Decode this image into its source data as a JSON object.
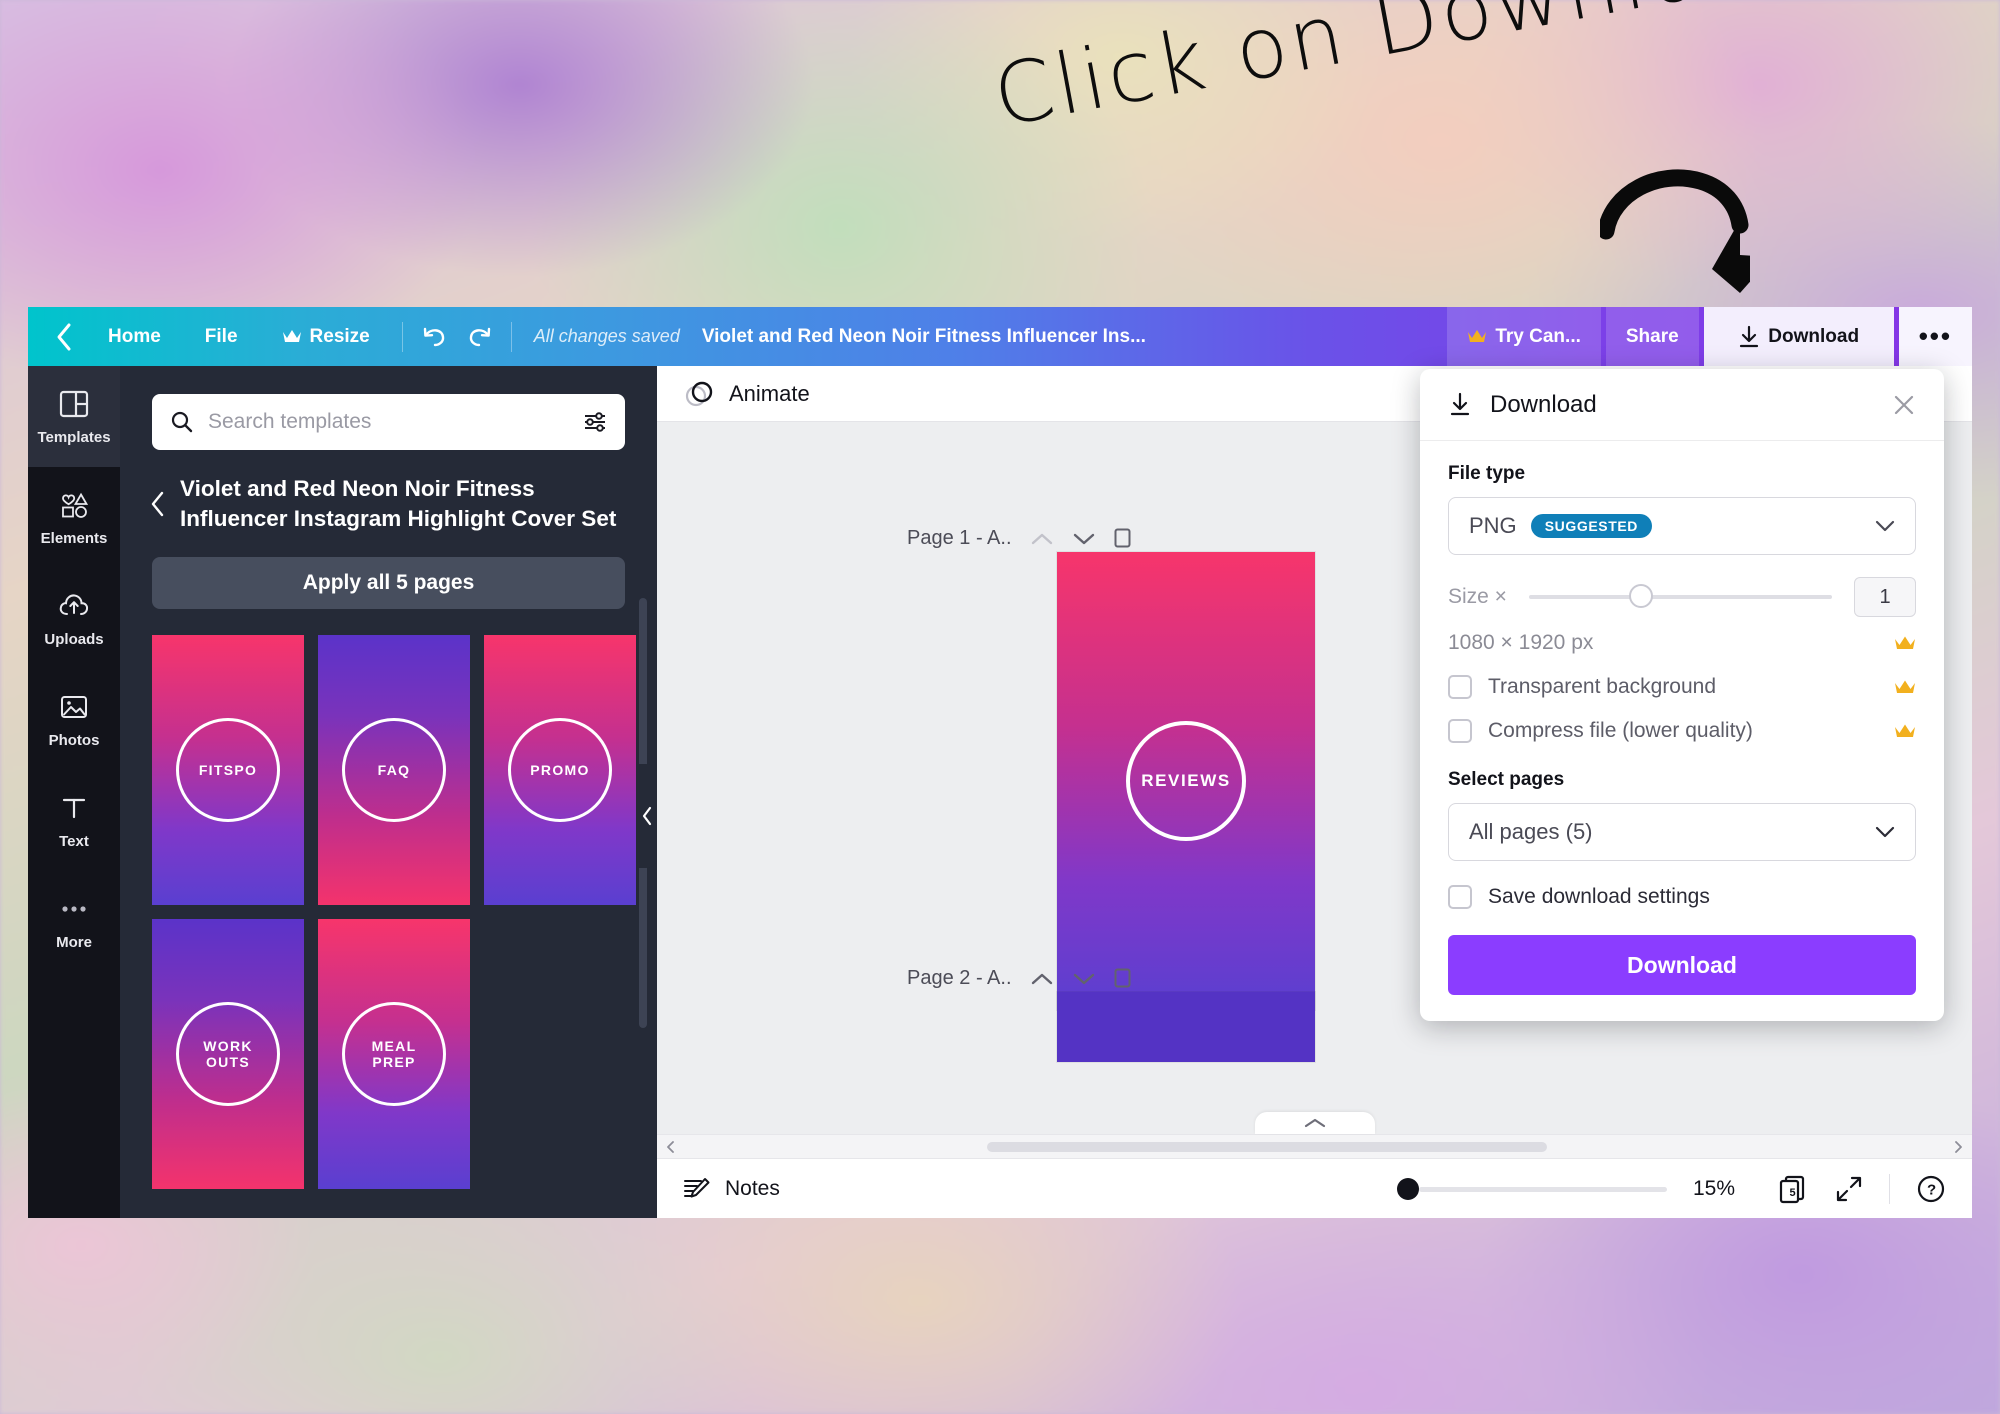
{
  "annotation": {
    "text": "Click on Download",
    "arrow_icon": "curved-arrow-icon"
  },
  "topbar": {
    "back_icon": "chevron-left-icon",
    "home_label": "Home",
    "file_label": "File",
    "resize_label": "Resize",
    "resize_icon": "crown-icon",
    "undo_icon": "undo-icon",
    "redo_icon": "redo-icon",
    "save_status": "All changes saved",
    "doc_title": "Violet and Red Neon Noir Fitness Influencer Ins...",
    "try_canva_label": "Try Can...",
    "try_canva_icon": "crown-icon",
    "share_label": "Share",
    "download_label": "Download",
    "download_icon": "download-icon",
    "more_label": "•••"
  },
  "rail": {
    "items": [
      {
        "label": "Templates",
        "icon": "templates-icon",
        "active": true
      },
      {
        "label": "Elements",
        "icon": "elements-icon",
        "active": false
      },
      {
        "label": "Uploads",
        "icon": "uploads-icon",
        "active": false
      },
      {
        "label": "Photos",
        "icon": "photos-icon",
        "active": false
      },
      {
        "label": "Text",
        "icon": "text-icon",
        "active": false
      },
      {
        "label": "More",
        "icon": "more-dots-icon",
        "active": false
      }
    ]
  },
  "panel": {
    "search_placeholder": "Search templates",
    "search_value": "",
    "search_icon": "search-icon",
    "filter_icon": "sliders-icon",
    "back_icon": "chevron-left-icon",
    "title": "Violet and Red Neon Noir Fitness Influencer Instagram Highlight Cover Set",
    "apply_label": "Apply all 5 pages",
    "collapse_icon": "chevron-left-icon",
    "thumbnails": [
      {
        "label": "FITSPO",
        "gradient": "pink-violet"
      },
      {
        "label": "FAQ",
        "gradient": "violet-pink"
      },
      {
        "label": "PROMO",
        "gradient": "pink-violet"
      },
      {
        "label": "WORK\nOUTS",
        "gradient": "violet-pink"
      },
      {
        "label": "MEAL\nPREP",
        "gradient": "pink-violet"
      }
    ]
  },
  "editor": {
    "animate_label": "Animate",
    "animate_icon": "animate-circles-icon",
    "pages": [
      {
        "header": "Page 1 - A..",
        "up_icon": "chevron-up-icon",
        "down_icon": "chevron-down-icon",
        "duplicate_icon": "duplicate-icon",
        "art_label": "REVIEWS",
        "gradient": "pink-violet"
      },
      {
        "header": "Page 2 - A..",
        "up_icon": "chevron-up-icon",
        "down_icon": "chevron-down-icon",
        "duplicate_icon": "duplicate-icon",
        "art_label": "",
        "gradient": "violet-solid"
      }
    ],
    "scroll_left_icon": "chevron-left-icon",
    "scroll_right_icon": "chevron-right-icon",
    "expand_icon": "chevron-up-icon"
  },
  "statusbar": {
    "notes_label": "Notes",
    "notes_icon": "notes-pencil-icon",
    "zoom_value": "15%",
    "page_count": "5",
    "pages_icon": "pages-stack-icon",
    "fullscreen_icon": "expand-arrows-icon",
    "help_icon": "help-question-icon"
  },
  "download_panel": {
    "title": "Download",
    "title_icon": "download-icon",
    "close_icon": "close-x-icon",
    "file_type_label": "File type",
    "file_type_value": "PNG",
    "file_type_badge": "SUGGESTED",
    "chevron_icon": "chevron-down-icon",
    "size_label": "Size ×",
    "size_value": "1",
    "dimensions": "1080 × 1920 px",
    "crown_icon": "crown-icon",
    "transparent_label": "Transparent background",
    "transparent_checked": false,
    "compress_label": "Compress file (lower quality)",
    "compress_checked": false,
    "select_pages_label": "Select pages",
    "select_pages_value": "All pages (5)",
    "save_settings_label": "Save download settings",
    "save_settings_checked": false,
    "submit_label": "Download"
  },
  "colors": {
    "brand_purple": "#8b3dff",
    "badge_blue": "#0f7fb8",
    "rail_dark": "#12131a",
    "panel_dark": "#252a37",
    "crown_gold": "#f2b01e",
    "neon_pink": "#f7356b",
    "neon_violet": "#5b33c9"
  }
}
